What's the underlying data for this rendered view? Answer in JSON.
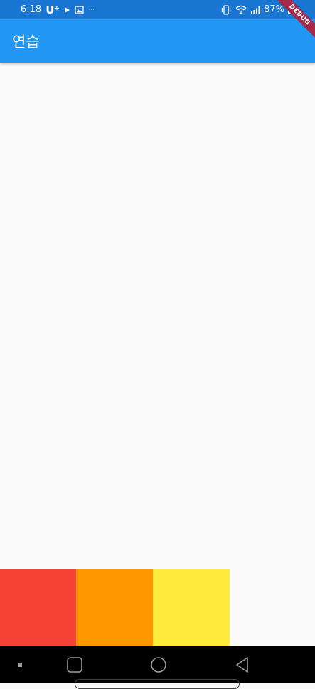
{
  "status_bar": {
    "time": "6:18",
    "carrier": "U⁺",
    "battery": "87%",
    "icons": [
      "play-icon",
      "image-icon",
      "more-dots-icon",
      "vibrate-icon",
      "wifi-icon",
      "signal-icon",
      "battery-icon"
    ],
    "dots": "···"
  },
  "app_bar": {
    "title": "연습",
    "color": "#2196f3"
  },
  "debug_banner": {
    "label": "DEBUG"
  },
  "boxes": [
    {
      "name": "red",
      "color": "#f44336"
    },
    {
      "name": "orange",
      "color": "#ff9800"
    },
    {
      "name": "yellow",
      "color": "#ffeb3b"
    }
  ],
  "nav_bar": {
    "icons": [
      "menu-dot-icon",
      "recents-icon",
      "home-icon",
      "back-icon"
    ]
  }
}
